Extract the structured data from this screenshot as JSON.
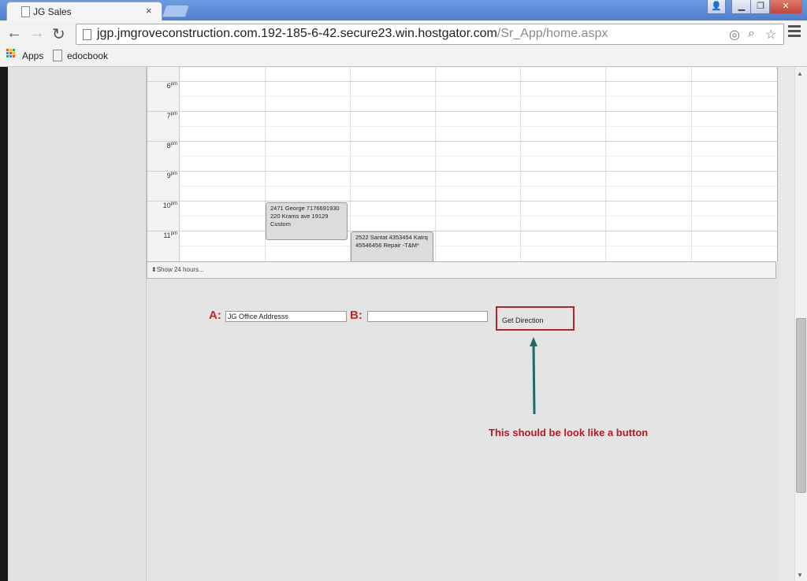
{
  "browser": {
    "tab_title": "JG Sales",
    "tab_close": "×",
    "url_host": "jgp.jmgroveconstruction.com.192-185-6-42.secure23.win.hostgator.com",
    "url_path": "/Sr_App/home.aspx",
    "bookmarks": [
      "Apps",
      "edocbook"
    ]
  },
  "calendar": {
    "hours": [
      {
        "label": "6",
        "suffix": "pm"
      },
      {
        "label": "7",
        "suffix": "pm"
      },
      {
        "label": "8",
        "suffix": "pm"
      },
      {
        "label": "9",
        "suffix": "pm"
      },
      {
        "label": "10",
        "suffix": "pm"
      },
      {
        "label": "11",
        "suffix": "pm"
      }
    ],
    "events": [
      {
        "lines": [
          "2471 George 7176691930",
          "220 Krams ave 19129",
          "Custom"
        ]
      },
      {
        "lines": [
          "2522 Santat 4353454 Katrq",
          "45546456 Repair -T&M*"
        ]
      }
    ],
    "footer_toggle": "Show 24 hours..."
  },
  "directions": {
    "label_a": "A:",
    "label_b": "B:",
    "input_a_value": "JG Office Addresss",
    "input_b_value": "",
    "button_label": "Get Direction"
  },
  "annotation": {
    "note": "This should be look like a button",
    "color": "#c0161c",
    "arrow_color": "#1f6b6b"
  }
}
